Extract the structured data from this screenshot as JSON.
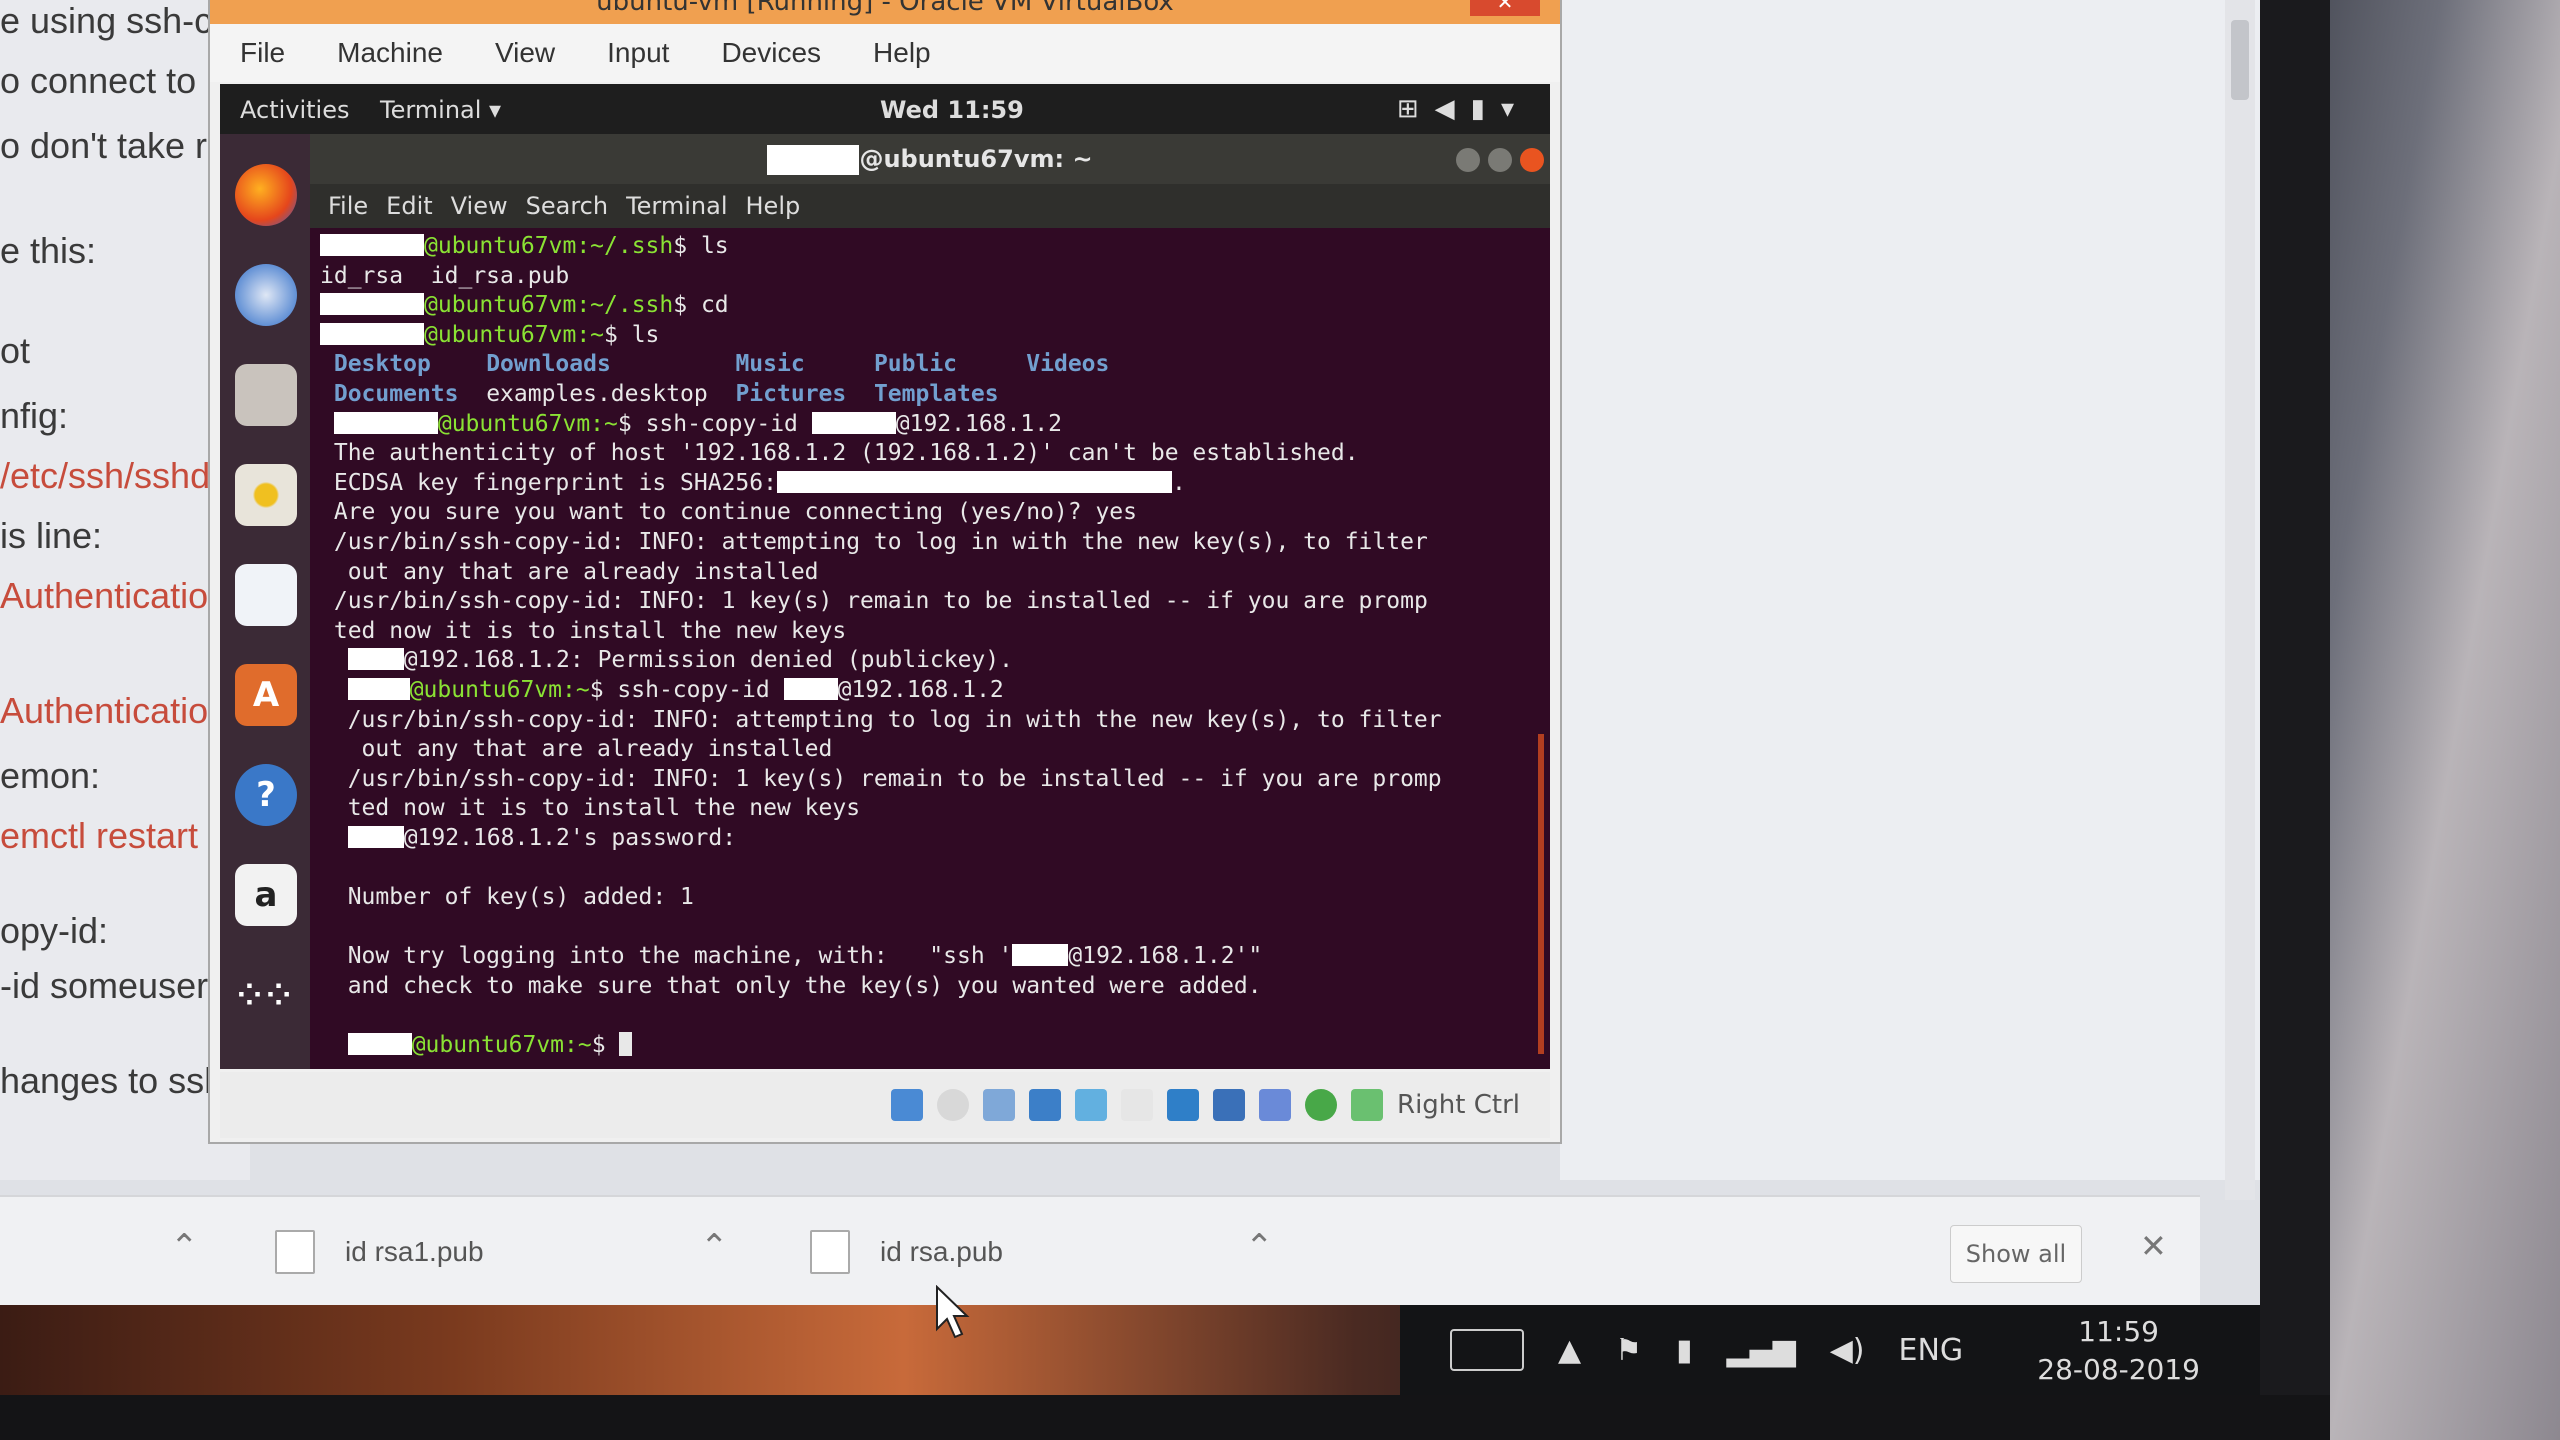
{
  "background_article": {
    "lines": [
      {
        "text": "e using ssh-c",
        "red": false
      },
      {
        "text": "o connect to",
        "red": false
      },
      {
        "text": "o don't take r",
        "red": false
      },
      {
        "text": "e this:",
        "red": false
      },
      {
        "text": "ot",
        "red": false
      },
      {
        "text": "nfig:",
        "red": false
      },
      {
        "text": "/etc/ssh/sshd",
        "red": true
      },
      {
        "text": "is line:",
        "red": false
      },
      {
        "text": "Authenticatio",
        "red": true
      },
      {
        "text": "Authenticatio",
        "red": true
      },
      {
        "text": "emon:",
        "red": false
      },
      {
        "text": "emctl restart s",
        "red": true
      },
      {
        "text": "opy-id:",
        "red": false
      },
      {
        "text": "-id someuser@",
        "red": false
      },
      {
        "text": "hanges to ssh_",
        "red": false
      }
    ]
  },
  "vbox": {
    "title": "ubuntu-vm [Running] - Oracle VM VirtualBox",
    "menu": [
      "File",
      "Machine",
      "View",
      "Input",
      "Devices",
      "Help"
    ],
    "host_key": "Right Ctrl"
  },
  "guest_topbar": {
    "activities": "Activities",
    "app": "Terminal ▾",
    "clock": "Wed 11:59",
    "sys_icons": [
      "network-icon",
      "volume-icon",
      "battery-icon",
      "menu-down-icon"
    ]
  },
  "dock": [
    "firefox-icon",
    "thunderbird-icon",
    "files-icon",
    "rhythmbox-icon",
    "writer-icon",
    "software-icon",
    "help-icon",
    "amazon-icon",
    "apps-grid-icon"
  ],
  "terminal": {
    "title": "@ubuntu67vm: ~",
    "menu": [
      "File",
      "Edit",
      "View",
      "Search",
      "Terminal",
      "Help"
    ],
    "lines": {
      "l1_prompt": "@ubuntu67vm:~/.ssh",
      "l1_cmd": "$ ls",
      "l2": "id_rsa  id_rsa.pub",
      "l3_prompt": "@ubuntu67vm:~/.ssh",
      "l3_cmd": "$ cd",
      "l4_prompt": "@ubuntu67vm:~",
      "l4_cmd": "$ ls",
      "ls_row1": [
        "Desktop",
        "Downloads",
        "",
        "Music",
        "Public",
        "Videos"
      ],
      "ls_row2": [
        "Documents",
        "examples.desktop",
        "Pictures",
        "Templates"
      ],
      "l7_prompt": "@ubuntu67vm:~",
      "l7_cmd": "$ ssh-copy-id ",
      "l7_host": "@192.168.1.2",
      "l8": "The authenticity of host '192.168.1.2 (192.168.1.2)' can't be established.",
      "l9": "ECDSA key fingerprint is SHA256:",
      "l9_end": ".",
      "l10": "Are you sure you want to continue connecting (yes/no)? yes",
      "l11": "/usr/bin/ssh-copy-id: INFO: attempting to log in with the new key(s), to filter",
      "l12": " out any that are already installed",
      "l13": "/usr/bin/ssh-copy-id: INFO: 1 key(s) remain to be installed -- if you are promp",
      "l14": "ted now it is to install the new keys",
      "l15": "@192.168.1.2: Permission denied (publickey).",
      "l16_prompt": "@ubuntu67vm:~",
      "l16_cmd": "$ ssh-copy-id ",
      "l16_host": "@192.168.1.2",
      "l17": "/usr/bin/ssh-copy-id: INFO: attempting to log in with the new key(s), to filter",
      "l18": " out any that are already installed",
      "l19": "/usr/bin/ssh-copy-id: INFO: 1 key(s) remain to be installed -- if you are promp",
      "l20": "ted now it is to install the new keys",
      "l21": "@192.168.1.2's password:",
      "l23": "Number of key(s) added: 1",
      "l25a": "Now try logging into the machine, with:   \"ssh '",
      "l25b": "@192.168.1.2'\"",
      "l26": "and check to make sure that only the key(s) you wanted were added.",
      "l28_prompt": "@ubuntu67vm:~",
      "l28_cmd": "$ "
    }
  },
  "downloads": {
    "items": [
      "id rsa1.pub",
      "id rsa.pub"
    ],
    "show_all": "Show all"
  },
  "windows_tray": {
    "lang": "ENG",
    "time": "11:59",
    "date": "28-08-2019"
  }
}
